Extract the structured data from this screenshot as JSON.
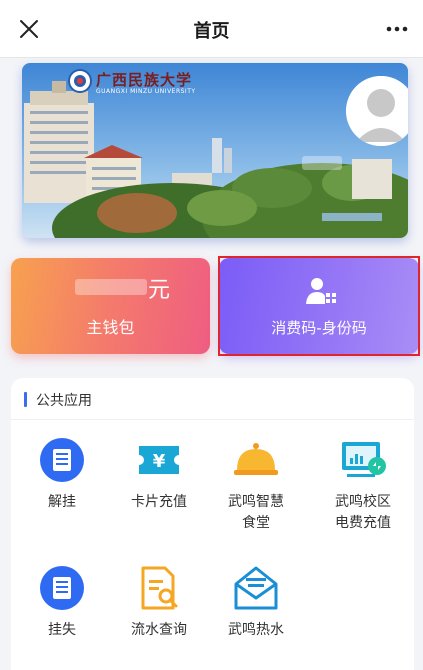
{
  "header": {
    "title": "首页",
    "close_icon": "close-icon",
    "more_icon": "more-icon"
  },
  "banner": {
    "school_name": "广西民族大学",
    "school_name_en": "GUANGXI MINZU UNIVERSITY",
    "logo_icon": "university-logo",
    "avatar_icon": "user-avatar"
  },
  "wallet_card": {
    "amount_unit": "元",
    "label": "主钱包"
  },
  "code_card": {
    "label": "消费码-身份码",
    "icon": "id-code-icon"
  },
  "section": {
    "title": "公共应用"
  },
  "apps": [
    {
      "label": "解挂",
      "icon": "unlock-card-icon"
    },
    {
      "label": "卡片充值",
      "icon": "card-recharge-icon"
    },
    {
      "label": "武鸣智慧\n食堂",
      "icon": "canteen-icon"
    },
    {
      "label": "武鸣校区\n电费充值",
      "icon": "electricity-icon"
    },
    {
      "label": "挂失",
      "icon": "report-loss-icon"
    },
    {
      "label": "流水查询",
      "icon": "transaction-query-icon"
    },
    {
      "label": "武鸣热水",
      "icon": "hot-water-icon"
    }
  ],
  "colors": {
    "accent_blue": "#2f6bf2",
    "wallet_gradient": [
      "#f7a14f",
      "#ef5d82"
    ],
    "code_gradient": [
      "#7b5cf7",
      "#a98ef6"
    ],
    "highlight_border": "#e0262a"
  }
}
